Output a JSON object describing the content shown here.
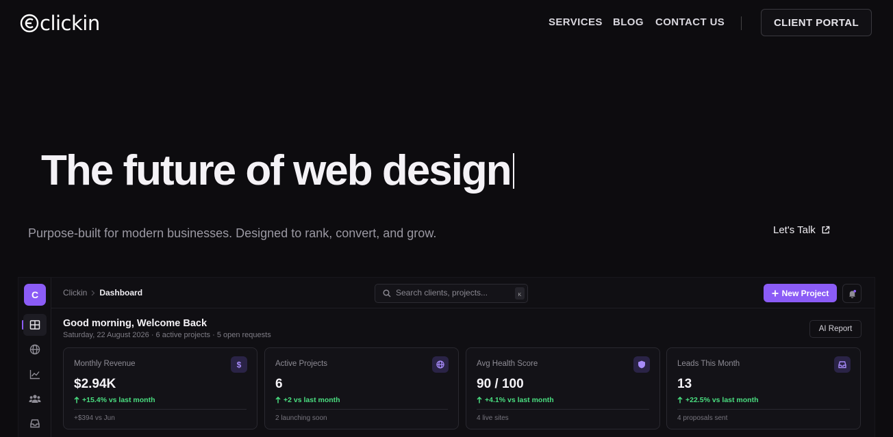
{
  "brand": {
    "name": "clickin"
  },
  "nav": {
    "items": [
      {
        "label": "SERVICES"
      },
      {
        "label": "BLOG"
      },
      {
        "label": "CONTACT US"
      }
    ],
    "portal_label": "CLIENT PORTAL"
  },
  "hero": {
    "title": "The future of web design",
    "subtitle": "Purpose-built for modern businesses. Designed to rank, convert, and grow.",
    "cta_label": "Let's Talk"
  },
  "dashboard": {
    "avatar_letter": "C",
    "breadcrumb": {
      "root": "Clickin",
      "current": "Dashboard"
    },
    "search": {
      "placeholder": "Search clients, projects...",
      "shortcut": "K"
    },
    "new_project_label": "New Project",
    "greeting": "Good morning, Welcome Back",
    "meta": "Saturday, 22 August 2026 · 6 active projects · 5 open requests",
    "ai_report_label": "AI Report",
    "accent_color": "#8b5cf6",
    "positive_color": "#4ade80",
    "sidebar": [
      {
        "icon": "grid-icon",
        "active": true
      },
      {
        "icon": "globe-icon",
        "active": false
      },
      {
        "icon": "chart-line-icon",
        "active": false
      },
      {
        "icon": "users-icon",
        "active": false
      },
      {
        "icon": "inbox-icon",
        "active": false
      }
    ],
    "stats": [
      {
        "label": "Monthly Revenue",
        "value": "$2.94K",
        "change": "+15.4% vs last month",
        "footnote": "+$394 vs Jun",
        "icon": "dollar-icon"
      },
      {
        "label": "Active Projects",
        "value": "6",
        "change": "+2 vs last month",
        "footnote": "2 launching soon",
        "icon": "globe-icon"
      },
      {
        "label": "Avg Health Score",
        "value": "90 / 100",
        "change": "+4.1% vs last month",
        "footnote": "4 live sites",
        "icon": "shield-icon"
      },
      {
        "label": "Leads This Month",
        "value": "13",
        "change": "+22.5% vs last month",
        "footnote": "4 proposals sent",
        "icon": "inbox-icon"
      }
    ]
  }
}
